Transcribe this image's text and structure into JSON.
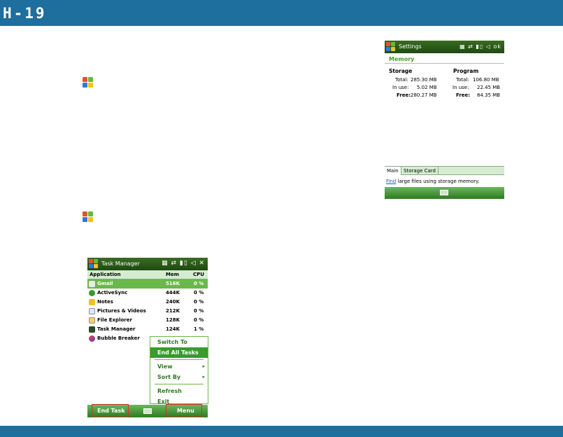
{
  "page": {
    "number": "H-19"
  },
  "settings": {
    "title": "Settings",
    "status": "ok",
    "subtitle": "Memory",
    "storage": {
      "header": "Storage",
      "total_label": "Total:",
      "total": "285.30 MB",
      "inuse_label": "In use:",
      "inuse": "5.02 MB",
      "free_label": "Free:",
      "free": "280.27 MB"
    },
    "program": {
      "header": "Program",
      "total_label": "Total:",
      "total": "106.80 MB",
      "inuse_label": "In use:",
      "inuse": "22.45 MB",
      "free_label": "Free:",
      "free": "84.35 MB"
    },
    "tabs": [
      "Main",
      "Storage Card"
    ],
    "find_link": "Find",
    "find_text": " large files using storage memory."
  },
  "task_manager": {
    "title": "Task Manager",
    "columns": [
      "Application",
      "Mem",
      "CPU"
    ],
    "rows": [
      {
        "app": "Gmail",
        "mem": "516K",
        "cpu": "0 %",
        "selected": true
      },
      {
        "app": "ActiveSync",
        "mem": "444K",
        "cpu": "0 %"
      },
      {
        "app": "Notes",
        "mem": "240K",
        "cpu": "0 %"
      },
      {
        "app": "Pictures & Videos",
        "mem": "212K",
        "cpu": "0 %"
      },
      {
        "app": "File Explorer",
        "mem": "128K",
        "cpu": "0 %"
      },
      {
        "app": "Task Manager",
        "mem": "124K",
        "cpu": "1 %"
      },
      {
        "app": "Bubble Breaker",
        "mem": "",
        "cpu": ""
      }
    ],
    "menu": [
      "Switch To",
      "End All Tasks",
      "View",
      "Sort By",
      "Refresh",
      "Exit"
    ],
    "left_softkey": "End Task",
    "right_softkey": "Menu"
  },
  "colors": {
    "header": "#1e6e9e",
    "highlight": "#e0282a",
    "accent_green": "#6ab84a"
  }
}
